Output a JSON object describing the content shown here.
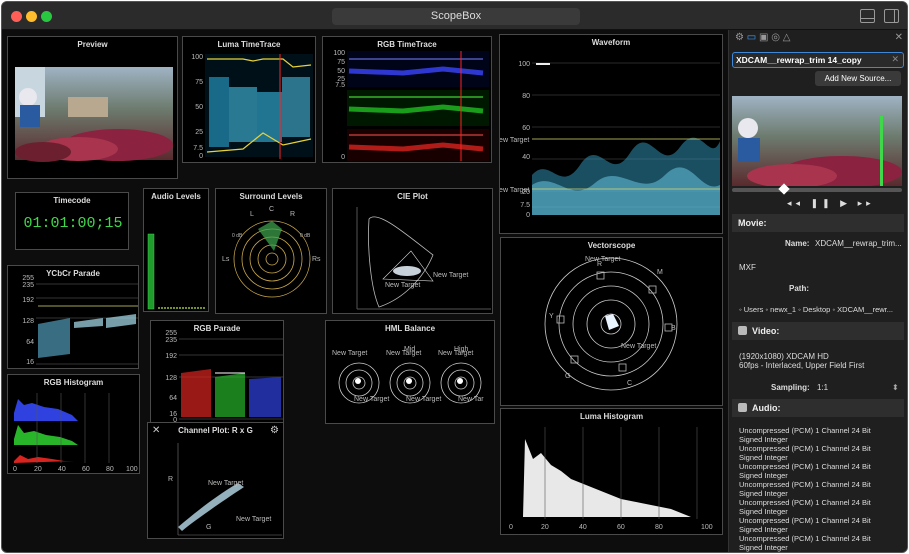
{
  "window": {
    "title": "ScopeBox",
    "traffic_colors": [
      "#ff5f57",
      "#febc2e",
      "#28c840"
    ]
  },
  "panels": {
    "preview": "Preview",
    "luma_timetrace": "Luma TimeTrace",
    "rgb_timetrace": "RGB TimeTrace",
    "waveform": "Waveform",
    "timecode": "Timecode",
    "audio_levels": "Audio Levels",
    "surround_levels": "Surround Levels",
    "cie_plot": "CIE Plot",
    "vectorscope": "Vectorscope",
    "ycbcr_parade": "YCbCr Parade",
    "rgb_parade": "RGB Parade",
    "hml_balance": "HML Balance",
    "rgb_histogram": "RGB Histogram",
    "channel_plot": "Channel Plot: R x G",
    "luma_histogram": "Luma Histogram"
  },
  "timecode_value": "01:01:00;15",
  "scales": {
    "luma_tt": [
      "100",
      "75",
      "50",
      "25",
      "7.5",
      "0"
    ],
    "rgb_tt": [
      "100",
      "75",
      "50",
      "25",
      "7.5",
      "0"
    ],
    "waveform": [
      "100",
      "80",
      "60",
      "40",
      "20",
      "7.5",
      "0"
    ],
    "ycbcr": [
      "255",
      "235",
      "192",
      "128",
      "64",
      "16"
    ],
    "rgb_parade": [
      "255",
      "235",
      "192",
      "128",
      "64",
      "16",
      "0"
    ],
    "rgb_hist_x": [
      "0",
      "20",
      "40",
      "60",
      "80",
      "100"
    ],
    "luma_hist_x": [
      "0",
      "20",
      "40",
      "60",
      "80",
      "100"
    ]
  },
  "surround_labels": {
    "l": "L",
    "c": "C",
    "r": "R",
    "ls": "Ls",
    "rs": "Rs",
    "db_l": "0 dB",
    "db_r": "0 dB"
  },
  "vectorscope_labels": {
    "r": "R",
    "m": "M",
    "b": "B",
    "c": "C",
    "g": "G",
    "y": "Y"
  },
  "target_label": "New Target",
  "target_label_short": "New Tar",
  "hml_mid": "Mid",
  "hml_high": "High",
  "channel_axes": {
    "r": "R",
    "g": "G"
  },
  "inspector": {
    "source_name": "XDCAM__rewrap_trim 14_copy",
    "add_source": "Add New Source...",
    "movie_header": "Movie:",
    "name_label": "Name:",
    "name_value": "XDCAM__rewrap_trim...",
    "format": "MXF",
    "path_label": "Path:",
    "path_value": "◦ Users ◦ newx_1 ◦ Desktop ◦ XDCAM__rewr...",
    "video_header": "Video:",
    "video_line1": "(1920x1080) XDCAM HD",
    "video_line2": "60fps - Interlaced, Upper Field First",
    "sampling_label": "Sampling:",
    "sampling_value": "1:1",
    "audio_header": "Audio:",
    "audio_lines": [
      "Uncompressed (PCM) 1 Channel 24 Bit",
      "Signed Integer",
      "Uncompressed (PCM) 1 Channel 24 Bit",
      "Signed Integer",
      "Uncompressed (PCM) 1 Channel 24 Bit",
      "Signed Integer",
      "Uncompressed (PCM) 1 Channel 24 Bit",
      "Signed Integer",
      "Uncompressed (PCM) 1 Channel 24 Bit",
      "Signed Integer",
      "Uncompressed (PCM) 1 Channel 24 Bit",
      "Signed Integer",
      "Uncompressed (PCM) 1 Channel 24 Bit",
      "Signed Integer"
    ]
  }
}
